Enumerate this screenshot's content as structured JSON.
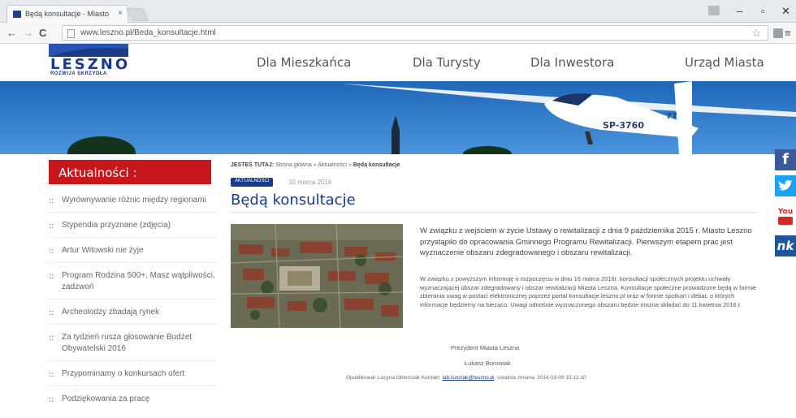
{
  "browser": {
    "tab_title": "Będą konsultacje - Miasto",
    "url": "www.leszno.pl/Beda_konsultacje.html",
    "min_label": "–",
    "restore_label": "▫",
    "close_label": "✕"
  },
  "site": {
    "logo_text": "LESZNO",
    "logo_sub": "ROZWIJA SKRZYDŁA",
    "nav": [
      "Dla Mieszkańca",
      "Dla Turysty",
      "Dla Inwestora",
      "Urząd Miasta"
    ]
  },
  "sidebar": {
    "header": "Aktualności :",
    "items": [
      "Wyrównywanie różnic między regionami",
      "Stypendia przyznane (zdjęcia)",
      "Artur Witowski nie żyje",
      "Program Rodzina 500+. Masz wątpliwości, zadzwoń",
      "Archeolodzy zbadają rynek",
      "Za tydzień rusza głosowanie Budżet Obywatelski 2016",
      "Przypominamy o konkursach ofert",
      "Podziękowania za pracę"
    ]
  },
  "article": {
    "breadcrumb_label": "JESTEŚ TUTAJ:",
    "breadcrumb_path": "Strona główna » Aktualności »",
    "breadcrumb_current": "Będą konsultacje",
    "badge": "AKTUALNOŚCI",
    "date": "10 marca 2016",
    "title": "Będą konsultacje",
    "lead": "W związku z wejściem w życie Ustawy o rewitalizacji z dnia 9 października 2015 r. Miasto Leszno przystąpiło do opracowania Gminnego Programu Rewitalizacji. Pierwszym etapem prac jest wyznaczenie obszaru zdegradowanego i obszaru rewitalizacji.",
    "body": "W związku z powyższym informuję o rozpoczęciu w dniu 16 marca 2016r. konsultacji społecznych projektu uchwały wyznaczającej obszar zdegradowany i obszar rewitalizacji Miasta Leszna. Konsultacje społeczne prowadzone będą w formie zbierania uwag w postaci elektronicznej poprzez portal konsultacje.leszno.pl oraz w formie spotkań i debat, o których informacje będziemy na bieżąco. Uwagi odnośnie wyznaczonego obszaru będzie można składać do 11 kwietnia 2016 r.",
    "signature_title": "Prezydent Miasta Leszna",
    "signature_name": "Łukasz Borowiak",
    "footer_prefix": "Opublikował: Lucyna Oblerczak Kontakt:",
    "footer_link": "lab.lszczak@leszno.pl",
    "footer_suffix": ", ostatnia zmiana: 2016-03-09 15:12:10"
  },
  "social": {
    "facebook": "f",
    "twitter": "t",
    "youtube": "You",
    "nk": "nk"
  },
  "colors": {
    "brand_blue": "#1a3a8a",
    "sidebar_red": "#c8161d",
    "facebook": "#3b5998",
    "twitter": "#1da1f2",
    "youtube": "#d32a27",
    "nk": "#1e5799"
  }
}
